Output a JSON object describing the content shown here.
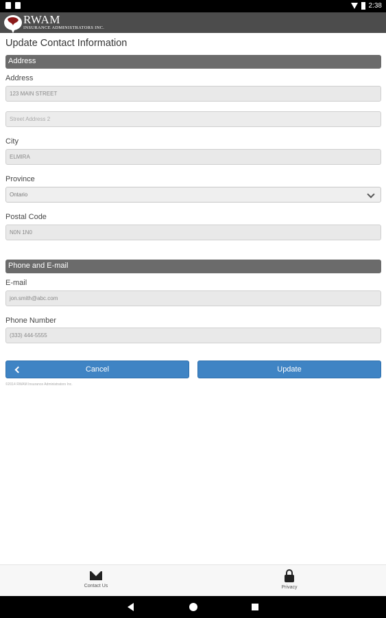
{
  "status_bar": {
    "time": "2:38"
  },
  "header": {
    "logo_text": "RWAM",
    "logo_subtext": "INSURANCE ADMINISTRATORS INC."
  },
  "page_title": "Update Contact Information",
  "address_section": {
    "title": "Address",
    "address_label": "Address",
    "address_value": "123 MAIN STREET",
    "street2_placeholder": "Street Address 2",
    "city_label": "City",
    "city_value": "ELMIRA",
    "province_label": "Province",
    "province_value": "Ontario",
    "postal_label": "Postal Code",
    "postal_value": "N0N 1N0"
  },
  "contact_section": {
    "title": "Phone and E-mail",
    "email_label": "E-mail",
    "email_value": "jon.smith@abc.com",
    "phone_label": "Phone Number",
    "phone_value": "(333) 444-5555"
  },
  "buttons": {
    "cancel": "Cancel",
    "update": "Update"
  },
  "copyright": "©2014 RWAM Insurance Administrators Inc.",
  "bottom_nav": {
    "contact": "Contact Us",
    "privacy": "Privacy"
  }
}
